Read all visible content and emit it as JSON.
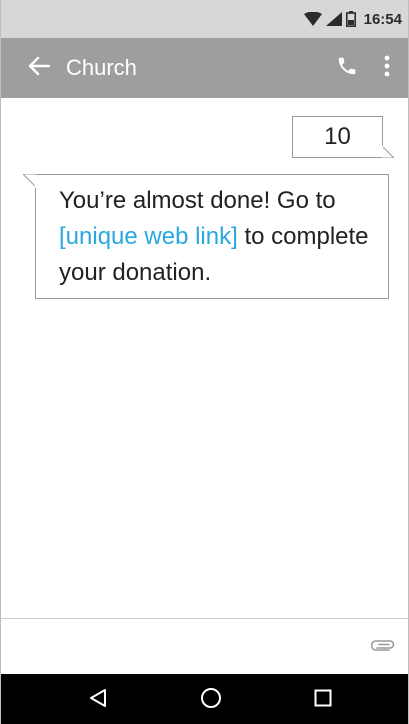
{
  "status_bar": {
    "time": "16:54",
    "icons": [
      "wifi-icon",
      "cell-signal-icon",
      "battery-icon"
    ]
  },
  "app_bar": {
    "title": "Church",
    "icons": [
      "back-arrow-icon",
      "phone-icon",
      "more-vert-icon"
    ]
  },
  "conversation": {
    "messages": [
      {
        "direction": "outgoing",
        "text": "10"
      },
      {
        "direction": "incoming",
        "text_before": "You’re almost done! Go to ",
        "link": "[unique web link]",
        "text_after": " to complete your donation."
      }
    ]
  },
  "compose": {
    "icons": [
      "paperclip-icon"
    ]
  },
  "nav_bar": {
    "icons": [
      "nav-back-icon",
      "nav-home-icon",
      "nav-recents-icon"
    ]
  },
  "colors": {
    "status_bar_bg": "#d7d7d7",
    "app_bar_bg": "#9e9e9e",
    "link": "#29a8e0",
    "nav_bar_bg": "#000000",
    "bubble_border": "#9a9a9a"
  }
}
